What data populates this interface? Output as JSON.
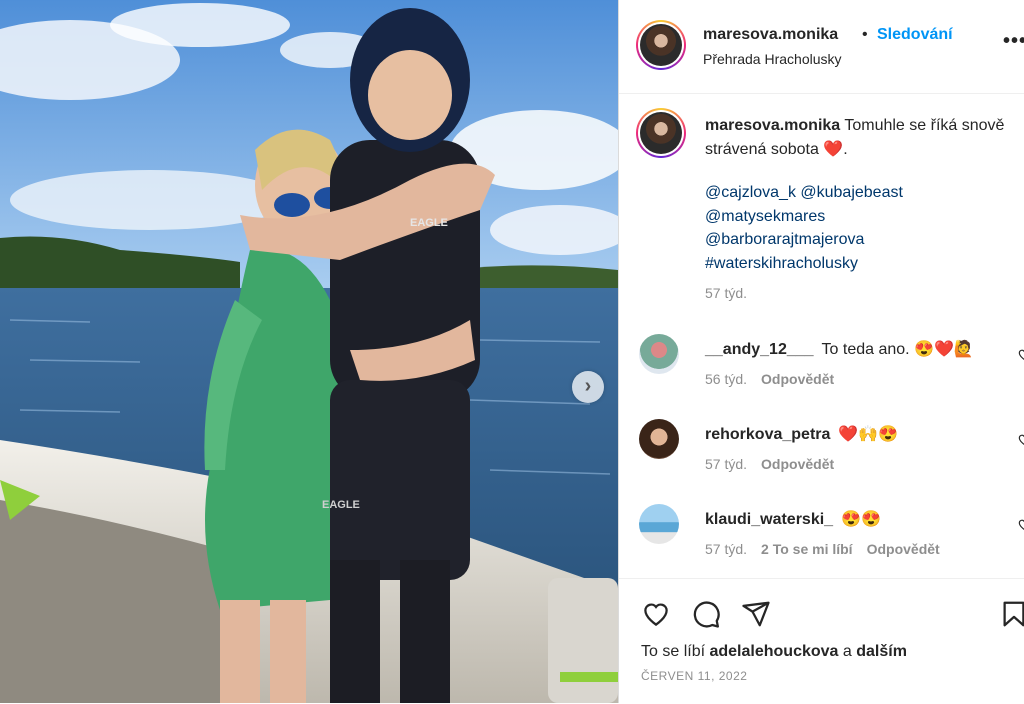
{
  "post": {
    "username": "maresova.monika",
    "follow_label": "Sledování",
    "location": "Přehrada Hracholusky",
    "more_icon": "•••"
  },
  "photo": {
    "vest_label": "EAGLE",
    "vest_label_2": "EAGLE",
    "next_arrow": "›"
  },
  "caption": {
    "username": "maresova.monika",
    "text": "Tomuhle se říká snově strávená sobota ❤️.",
    "tags": [
      "@cajzlova_k @kubajebeast",
      "@matysekmares",
      "@barborarajtmajerova",
      "#waterskihracholusky"
    ],
    "time": "57 týd."
  },
  "comments": [
    {
      "username": "__andy_12___",
      "text": "To teda ano. 😍❤️🙋",
      "time": "56 týd.",
      "likes": "",
      "reply": "Odpovědět"
    },
    {
      "username": "rehorkova_petra",
      "text": "❤️🙌😍",
      "time": "57 týd.",
      "likes": "",
      "reply": "Odpovědět"
    },
    {
      "username": "klaudi_waterski_",
      "text": "😍😍",
      "time": "57 týd.",
      "likes": "2 To se mi líbí",
      "reply": "Odpovědět"
    }
  ],
  "likes": {
    "prefix": "To se líbí",
    "user": "adelalehouckova",
    "middle": "a",
    "suffix": "dalším"
  },
  "date": "ČERVEN 11, 2022",
  "icons": {
    "like": "heart-icon",
    "comment": "comment-icon",
    "share": "send-icon",
    "save": "bookmark-icon"
  }
}
